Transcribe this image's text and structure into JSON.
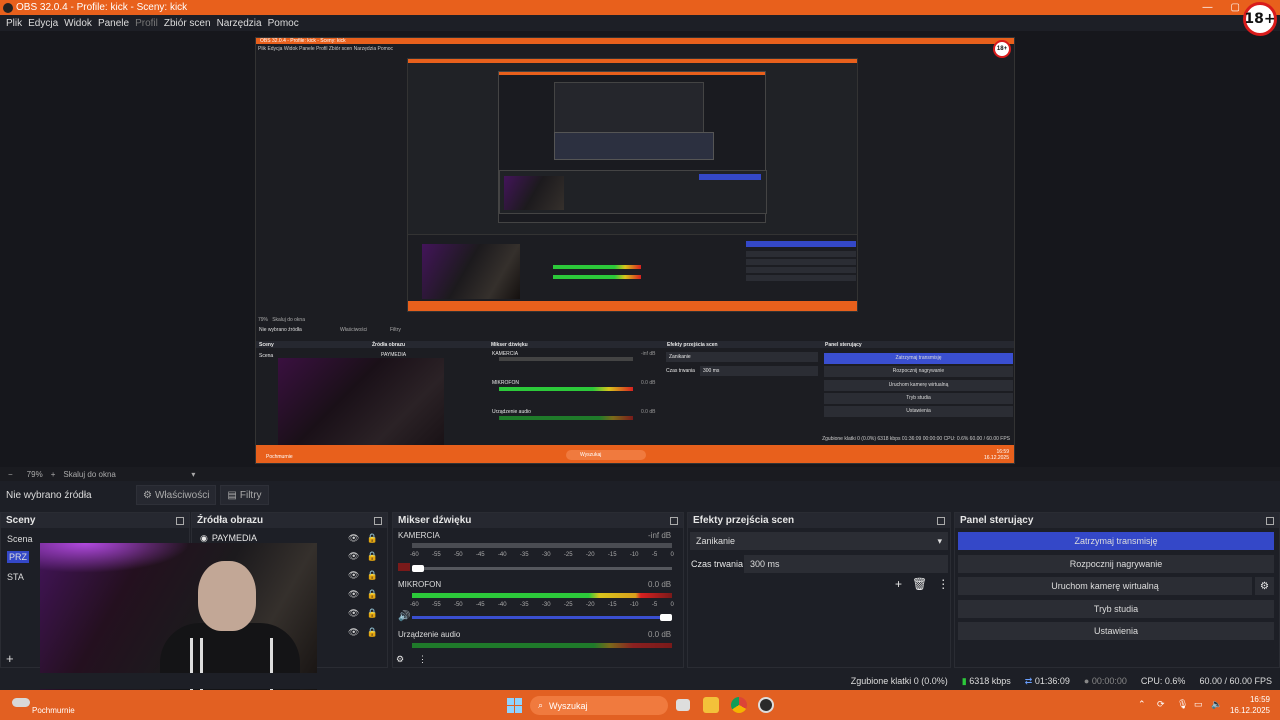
{
  "window": {
    "title": "OBS 32.0.4 - Profile: kick - Sceny: kick"
  },
  "menu": [
    "Plik",
    "Edycja",
    "Widok",
    "Panele",
    "Profil",
    "Zbiór scen",
    "Narzędzia",
    "Pomoc"
  ],
  "badge": "18+",
  "nested": {
    "title": "OBS 32.0.4 - Profile: kick - Sceny: kick",
    "menu": "Plik  Edycja  Widok  Panele  Profil  Zbiór scen  Narzędzia  Pomoc",
    "zoom": "79%",
    "scale": "Skaluj do okna",
    "no_source": "Nie wybrano źródła",
    "props": "Właściwości",
    "filters": "Filtry",
    "scenes_title": "Sceny",
    "sources_title": "Źródła obrazu",
    "mixer_title": "Mikser dźwięku",
    "transitions_title": "Efekty przejścia scen",
    "controls_title": "Panel sterujący",
    "scene_label": "Scena",
    "source_paymedia": "PAYMEDIA",
    "kamercia": "KAMERCIA",
    "mikrofon": "MIKROFON",
    "urzadzenie": "Urządzenie audio",
    "db_inf": "-inf dB",
    "db_0": "0.0 dB",
    "zanikanie": "Zanikanie",
    "czas": "Czas trwania",
    "ms": "300 ms",
    "btn_stop": "Zatrzymaj transmisję",
    "btn_record": "Rozpocznij nagrywanie",
    "btn_vcam": "Uruchom kamerę wirtualną",
    "btn_studio": "Tryb studia",
    "btn_settings": "Ustawienia",
    "status": "Zgubione klatki 0 (0.0%)   6318 kbps   01:36:09   00:00:00   CPU: 0.6%   60.00 / 60.00 FPS",
    "weather": "Pochmurnie",
    "search": "Wyszukaj",
    "time": "16:59",
    "date": "16.12.2025"
  },
  "zoom": {
    "percent": "79%",
    "minus": "−",
    "plus": "+",
    "scale_label": "Skaluj do okna"
  },
  "source_toolbar": {
    "no_source": "Nie wybrano źródła",
    "properties": "Właściwości",
    "filters": "Filtry"
  },
  "docks": {
    "scenes": {
      "title": "Sceny",
      "item_scena": "Scena",
      "item_prz": "PRZ",
      "item_sta": "STA",
      "add": "+"
    },
    "sources": {
      "title": "Źródła obrazu",
      "first": "PAYMEDIA"
    },
    "mixer": {
      "title": "Mikser dźwięku",
      "ch1": {
        "name": "KAMERCIA",
        "db": "-inf dB"
      },
      "ch2": {
        "name": "MIKROFON",
        "db": "0.0 dB"
      },
      "ch3": {
        "name": "Urządzenie audio",
        "db": "0.0 dB"
      },
      "ticks": [
        "-60",
        "-55",
        "-50",
        "-45",
        "-40",
        "-35",
        "-30",
        "-25",
        "-20",
        "-15",
        "-10",
        "-5",
        "0"
      ]
    },
    "transitions": {
      "title": "Efekty przejścia scen",
      "type": "Zanikanie",
      "duration_label": "Czas trwania",
      "duration": "300 ms"
    },
    "controls": {
      "title": "Panel sterujący",
      "stop_stream": "Zatrzymaj transmisję",
      "start_record": "Rozpocznij nagrywanie",
      "virtual_cam": "Uruchom kamerę wirtualną",
      "studio_mode": "Tryb studia",
      "settings": "Ustawienia"
    }
  },
  "status": {
    "dropped": "Zgubione klatki 0 (0.0%)",
    "bitrate": "6318 kbps",
    "stream_time": "01:36:09",
    "record_time": "00:00:00",
    "cpu": "CPU: 0.6%",
    "fps": "60.00 / 60.00 FPS"
  },
  "taskbar": {
    "weather": "Pochmurnie",
    "search": "Wyszukaj",
    "time": "16:59",
    "date": "16.12.2025"
  },
  "colors": {
    "accent_orange": "#e8601c",
    "blue_button": "#3448c8",
    "meter_green": "#2cc93a"
  }
}
